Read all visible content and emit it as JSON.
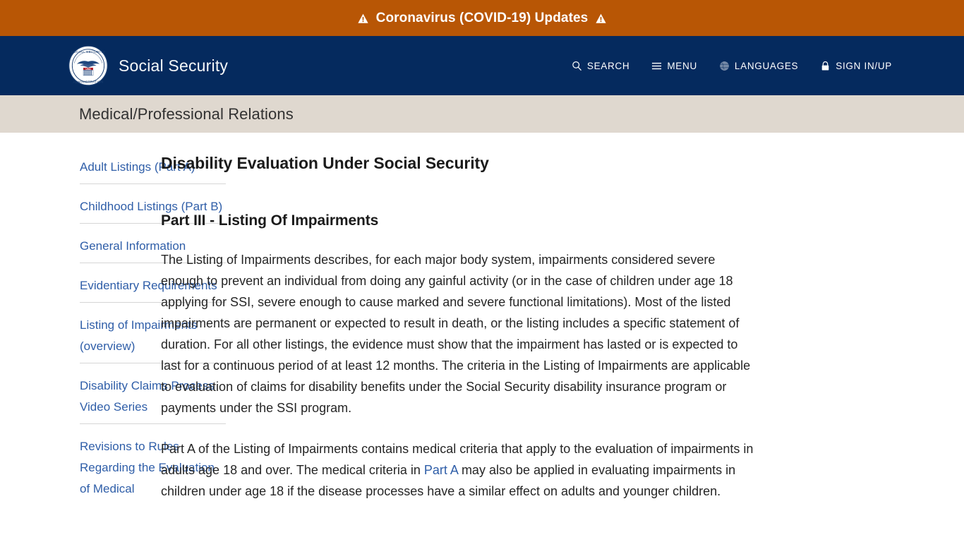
{
  "alert_banner": {
    "text": "Coronavirus (COVID-19) Updates",
    "left_icon": "warning-triangle-icon",
    "right_icon": "warning-triangle-icon",
    "background_color": "#b85605",
    "text_color": "#ffffff"
  },
  "masthead": {
    "logo_icon": "ssa-seal-icon",
    "brand_name": "Social Security",
    "background_color": "#052a5e",
    "nav": [
      {
        "label": "SEARCH",
        "icon": "search-icon"
      },
      {
        "label": "MENU",
        "icon": "hamburger-menu-icon"
      },
      {
        "label": "LANGUAGES",
        "icon": "globe-icon"
      },
      {
        "label": "SIGN IN/UP",
        "icon": "lock-icon"
      }
    ]
  },
  "section_bar": {
    "title": "Medical/Professional Relations",
    "background_color": "#dfd8cf"
  },
  "sidebar": {
    "items": [
      {
        "label": "Adult Listings (Part A)"
      },
      {
        "label": "Childhood Listings (Part B)"
      },
      {
        "label": "General Information"
      },
      {
        "label": "Evidentiary Requirements"
      },
      {
        "label": "Listing of Impairments (overview)"
      },
      {
        "label": "Disability Claims Process Video Series"
      },
      {
        "label": "Revisions to Rules Regarding the Evaluation of Medical"
      }
    ],
    "link_color": "#2f5ea8"
  },
  "main": {
    "page_title": "Disability Evaluation Under Social Security",
    "sub_title": "Part III - Listing Of Impairments",
    "paragraph_1": "The Listing of Impairments describes, for each major body system, impairments considered severe enough to prevent an individual from doing any gainful activity (or in the case of children under age 18 applying for SSI, severe enough to cause marked and severe functional limitations). Most of the listed impairments are permanent or expected to result in death, or the listing includes a specific statement of duration. For all other listings, the evidence must show that the impairment has lasted or is expected to last for a continuous period of at least 12 months. The criteria in the Listing of Impairments are applicable to evaluation of claims for disability benefits under the Social Security disability insurance program or payments under the SSI program.",
    "paragraph_2_part_a": "Part A of the Listing of Impairments contains medical criteria that apply to the evaluation of impairments in adults age 18 and over. The medical criteria in ",
    "paragraph_2_link": "Part A",
    "paragraph_2_part_b": " may also be applied in evaluating impairments in children under age 18 if the disease processes have a similar effect on adults and younger children."
  }
}
